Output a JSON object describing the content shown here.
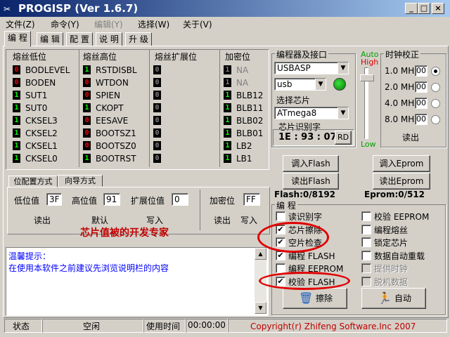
{
  "window": {
    "title": "PROGISP (Ver 1.6.7)",
    "app_icon": "scissors-icon"
  },
  "menu": [
    "文件(Z)",
    "命令(Y)",
    "编辑(Y)",
    "选择(W)",
    "关于(V)"
  ],
  "tabs": [
    "编 程",
    "编 辑",
    "配 置",
    "说 明",
    "升 级"
  ],
  "fuse_groups": {
    "low": {
      "title": "熔丝低位",
      "items": [
        {
          "bit": "0",
          "label": "BODLEVEL",
          "color": "#ff0000"
        },
        {
          "bit": "0",
          "label": "BODEN",
          "color": "#ff0000"
        },
        {
          "bit": "1",
          "label": "SUT1",
          "color": "#00ff00"
        },
        {
          "bit": "1",
          "label": "SUT0",
          "color": "#00ff00"
        },
        {
          "bit": "1",
          "label": "CKSEL3",
          "color": "#00ff00"
        },
        {
          "bit": "1",
          "label": "CKSEL2",
          "color": "#00ff00"
        },
        {
          "bit": "1",
          "label": "CKSEL1",
          "color": "#00ff00"
        },
        {
          "bit": "1",
          "label": "CKSEL0",
          "color": "#00ff00"
        }
      ]
    },
    "high": {
      "title": "熔丝高位",
      "items": [
        {
          "bit": "1",
          "label": "RSTDISBL",
          "color": "#00ff00"
        },
        {
          "bit": "0",
          "label": "WTDON",
          "color": "#ff0000"
        },
        {
          "bit": "0",
          "label": "SPIEN",
          "color": "#ff0000"
        },
        {
          "bit": "1",
          "label": "CKOPT",
          "color": "#00ff00"
        },
        {
          "bit": "0",
          "label": "EESAVE",
          "color": "#ff0000"
        },
        {
          "bit": "0",
          "label": "BOOTSZ1",
          "color": "#ff0000"
        },
        {
          "bit": "0",
          "label": "BOOTSZ0",
          "color": "#ff0000"
        },
        {
          "bit": "1",
          "label": "BOOTRST",
          "color": "#00ff00"
        }
      ]
    },
    "ext": {
      "title": "熔丝扩展位",
      "items": [
        {
          "bit": "0",
          "label": "",
          "color": "#808080"
        },
        {
          "bit": "0",
          "label": "",
          "color": "#808080"
        },
        {
          "bit": "0",
          "label": "",
          "color": "#808080"
        },
        {
          "bit": "0",
          "label": "",
          "color": "#808080"
        },
        {
          "bit": "0",
          "label": "",
          "color": "#808080"
        },
        {
          "bit": "0",
          "label": "",
          "color": "#808080"
        },
        {
          "bit": "0",
          "label": "",
          "color": "#808080"
        },
        {
          "bit": "0",
          "label": "",
          "color": "#808080"
        }
      ]
    },
    "lock": {
      "title": "加密位",
      "items": [
        {
          "bit": "1",
          "label": "NA",
          "color": "#808080",
          "dim": true
        },
        {
          "bit": "1",
          "label": "NA",
          "color": "#808080",
          "dim": true
        },
        {
          "bit": "1",
          "label": "BLB12",
          "color": "#00ff00"
        },
        {
          "bit": "1",
          "label": "BLB11",
          "color": "#00ff00"
        },
        {
          "bit": "1",
          "label": "BLB02",
          "color": "#00ff00"
        },
        {
          "bit": "1",
          "label": "BLB01",
          "color": "#00ff00"
        },
        {
          "bit": "1",
          "label": "LB2",
          "color": "#00ff00"
        },
        {
          "bit": "1",
          "label": "LB1",
          "color": "#00ff00"
        }
      ]
    }
  },
  "config_tabs": [
    "位配置方式",
    "向导方式"
  ],
  "config": {
    "low_label": "低位值",
    "low_value": "3F",
    "high_label": "高位值",
    "high_value": "91",
    "ext_label": "扩展位值",
    "ext_value": "0",
    "lock_label": "加密位",
    "lock_value": "FF",
    "read": "读出",
    "default": "默认",
    "write": "写入",
    "lock_read": "读出",
    "lock_write": "写入",
    "scroll_text": "芯片值被的开发专家"
  },
  "tips": {
    "title": "温馨提示：",
    "text": "在使用本软件之前建议先浏览说明栏的内容"
  },
  "programmer": {
    "title": "编程器及接口",
    "device": "USBASP",
    "port": "usb",
    "chip_title": "选择芯片",
    "chip": "ATmega8",
    "sig_title": "芯片识别字",
    "signature": "1E : 93 : 07",
    "rd": "RD"
  },
  "auto_label": "Auto",
  "high_label": "High",
  "low_label": "Low",
  "clock": {
    "title": "时钟校正",
    "rows": [
      {
        "label": "1.0 MHz",
        "v": "00",
        "sel": true
      },
      {
        "label": "2.0 MHz",
        "v": "00",
        "sel": false
      },
      {
        "label": "4.0 MHz",
        "v": "00",
        "sel": false
      },
      {
        "label": "8.0 MHz",
        "v": "00",
        "sel": false
      }
    ],
    "read": "读出"
  },
  "flash_buttons": {
    "load_flash": "调入Flash",
    "save_flash": "读出Flash",
    "load_eprom": "调入Eprom",
    "save_eprom": "读出Eprom"
  },
  "flash_info": "Flash:0/8192",
  "eprom_info": "Eprom:0/512",
  "prog": {
    "title": "编 程",
    "left": [
      {
        "label": "读识别字",
        "checked": false,
        "disabled": false
      },
      {
        "label": "芯片擦除",
        "checked": true,
        "disabled": false
      },
      {
        "label": "空片检查",
        "checked": true,
        "disabled": false
      },
      {
        "label": "编程 FLASH",
        "checked": true,
        "disabled": false
      },
      {
        "label": "编程 EEPROM",
        "checked": false,
        "disabled": false
      },
      {
        "label": "校验 FLASH",
        "checked": true,
        "disabled": false
      }
    ],
    "right": [
      {
        "label": "校验 EEPROM",
        "checked": false,
        "disabled": false
      },
      {
        "label": "编程熔丝",
        "checked": false,
        "disabled": false
      },
      {
        "label": "锁定芯片",
        "checked": false,
        "disabled": false
      },
      {
        "label": "数据自动重载",
        "checked": false,
        "disabled": false
      },
      {
        "label": "提供时钟",
        "checked": false,
        "disabled": true
      },
      {
        "label": "脱机数据",
        "checked": false,
        "disabled": true
      }
    ],
    "erase": "擦除",
    "auto": "自动"
  },
  "status": {
    "state_label": "状态",
    "state": "空闲",
    "time_label": "使用时间",
    "time": "00:00:00",
    "copyright": "Copyright(r) Zhifeng Software.Inc 2007"
  },
  "colors": {
    "title_start": "#0a246a",
    "title_end": "#a6caf0",
    "annotation": "#e00000",
    "copyright": "#c00000",
    "tip_text": "#0000ff"
  }
}
